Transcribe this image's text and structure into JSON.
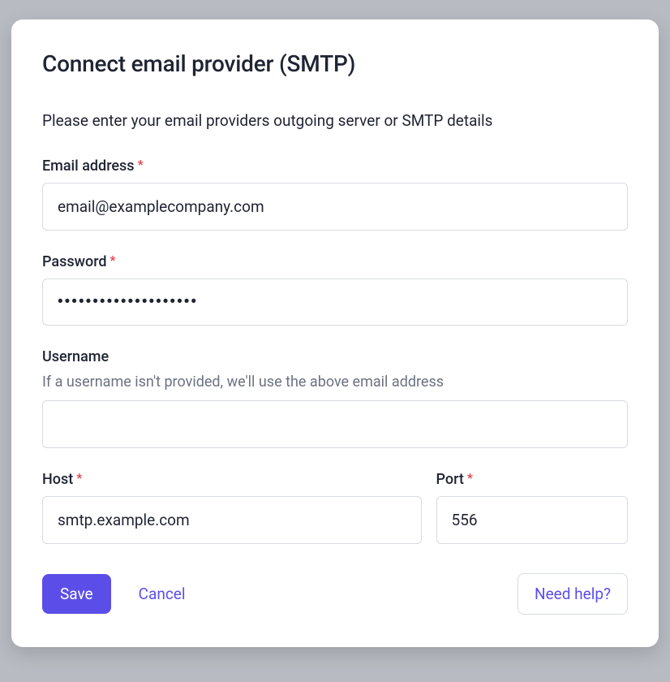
{
  "modal": {
    "title": "Connect email provider (SMTP)",
    "subtitle": "Please enter your email providers outgoing server or SMTP details"
  },
  "fields": {
    "email": {
      "label": "Email address",
      "value": "email@examplecompany.com"
    },
    "password": {
      "label": "Password",
      "value": "••••••••••••••••••••"
    },
    "username": {
      "label": "Username",
      "hint": "If a username isn't provided, we'll use the above email address",
      "value": ""
    },
    "host": {
      "label": "Host",
      "value": "smtp.example.com"
    },
    "port": {
      "label": "Port",
      "value": "556"
    }
  },
  "actions": {
    "save": "Save",
    "cancel": "Cancel",
    "help": "Need help?"
  }
}
